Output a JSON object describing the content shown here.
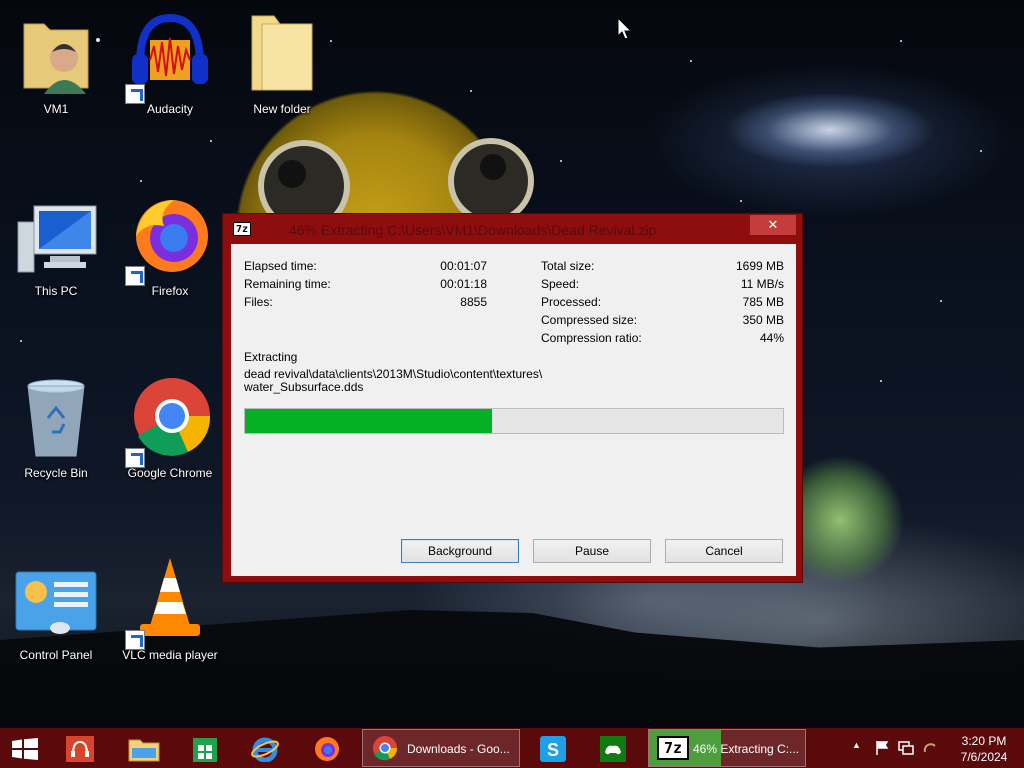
{
  "desktop": {
    "icons": [
      {
        "label": "VM1"
      },
      {
        "label": "Audacity"
      },
      {
        "label": "New folder"
      },
      {
        "label": "This PC"
      },
      {
        "label": "Firefox"
      },
      {
        "label": "Recycle Bin"
      },
      {
        "label": "Google Chrome"
      },
      {
        "label": "Control Panel"
      },
      {
        "label": "VLC media player"
      }
    ]
  },
  "zip_dialog": {
    "app_icon": "7z",
    "title": "46% Extracting C:\\Users\\VM1\\Downloads\\Dead Revival.zip",
    "close_glyph": "✕",
    "stats_left": [
      {
        "label": "Elapsed time:",
        "value": "00:01:07"
      },
      {
        "label": "Remaining time:",
        "value": "00:01:18"
      },
      {
        "label": "Files:",
        "value": "8855"
      }
    ],
    "stats_right": [
      {
        "label": "Total size:",
        "value": "1699 MB"
      },
      {
        "label": "Speed:",
        "value": "11 MB/s"
      },
      {
        "label": "Processed:",
        "value": "785 MB"
      },
      {
        "label": "Compressed size:",
        "value": "350 MB"
      },
      {
        "label": "Compression ratio:",
        "value": "44%"
      }
    ],
    "operation": "Extracting",
    "current_path_line1": "dead revival\\data\\clients\\2013M\\Studio\\content\\textures\\",
    "current_path_line2": "water_Subsurface.dds",
    "progress_fraction": 0.46,
    "buttons": {
      "background": "Background",
      "pause": "Pause",
      "cancel": "Cancel"
    }
  },
  "taskbar": {
    "chrome_label": "Downloads - Goo...",
    "zip_label": "46% Extracting C:...",
    "zip_icon": "7z",
    "clock_time": "3:20 PM",
    "clock_date": "7/6/2024",
    "tray_arrow": "▲",
    "colors": {
      "taskbar": "#5b0a0c",
      "accent_green": "#06b025"
    }
  }
}
